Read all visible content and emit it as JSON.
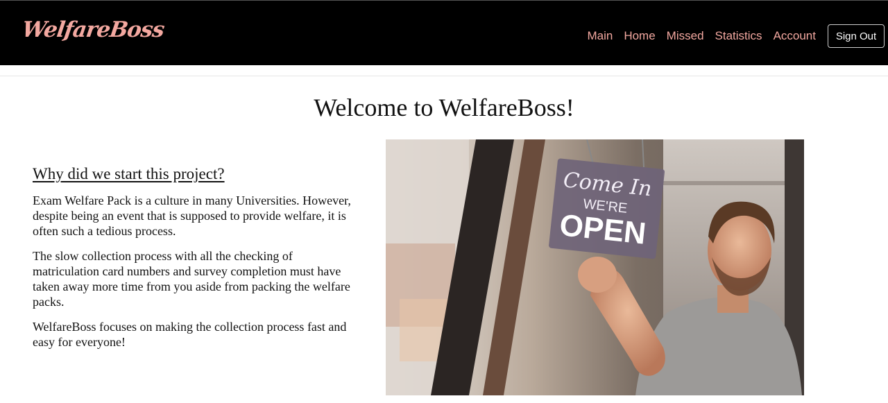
{
  "navbar": {
    "brand": "WelfareBoss",
    "links": [
      "Main",
      "Home",
      "Missed",
      "Statistics",
      "Account"
    ],
    "signout_label": "Sign Out"
  },
  "main": {
    "title": "Welcome to WelfareBoss!",
    "section_heading": "Why did we start this project?",
    "paragraphs": [
      "Exam Welfare Pack is a culture in many Universities. However, despite being an event that is supposed to provide welfare, it is often such a tedious process.",
      "The slow collection process with all the checking of matriculation card numbers and survey completion must have taken away more time from you aside from packing the welfare packs.",
      "WelfareBoss focuses on making the collection process fast and easy for everyone!"
    ]
  },
  "hero_image": {
    "sign_script": "Come In",
    "sign_line1": "WE'RE",
    "sign_line2": "OPEN"
  },
  "colors": {
    "navbar_bg": "#000000",
    "link": "#f3a8a0",
    "signout_text": "#ffffff"
  }
}
